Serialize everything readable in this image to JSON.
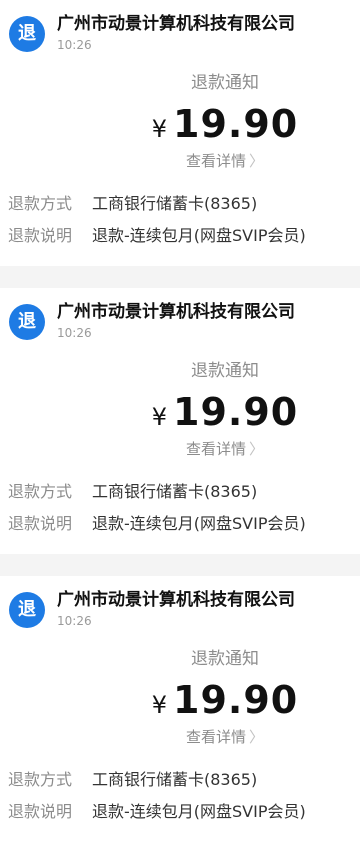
{
  "messages": [
    {
      "app_icon_text": "退",
      "sender": "广州市动景计算机科技有限公司",
      "time": "10:26",
      "title": "退款通知",
      "currency": "¥",
      "amount": "19.90",
      "details_link": "查看详情",
      "fields": [
        {
          "label": "退款方式",
          "value": "工商银行储蓄卡(8365)"
        },
        {
          "label": "退款说明",
          "value": "退款-连续包月(网盘SVIP会员)"
        }
      ]
    },
    {
      "app_icon_text": "退",
      "sender": "广州市动景计算机科技有限公司",
      "time": "10:26",
      "title": "退款通知",
      "currency": "¥",
      "amount": "19.90",
      "details_link": "查看详情",
      "fields": [
        {
          "label": "退款方式",
          "value": "工商银行储蓄卡(8365)"
        },
        {
          "label": "退款说明",
          "value": "退款-连续包月(网盘SVIP会员)"
        }
      ]
    },
    {
      "app_icon_text": "退",
      "sender": "广州市动景计算机科技有限公司",
      "time": "10:26",
      "title": "退款通知",
      "currency": "¥",
      "amount": "19.90",
      "details_link": "查看详情",
      "fields": [
        {
          "label": "退款方式",
          "value": "工商银行储蓄卡(8365)"
        },
        {
          "label": "退款说明",
          "value": "退款-连续包月(网盘SVIP会员)"
        }
      ]
    }
  ],
  "icons": {
    "app_icon": "refund-icon",
    "chevron": "chevron-right-icon",
    "chevron_glyph": "〉"
  },
  "colors": {
    "app_icon_bg": "#1e7be4",
    "page_bg": "#f4f4f4",
    "card_bg": "#ffffff"
  }
}
